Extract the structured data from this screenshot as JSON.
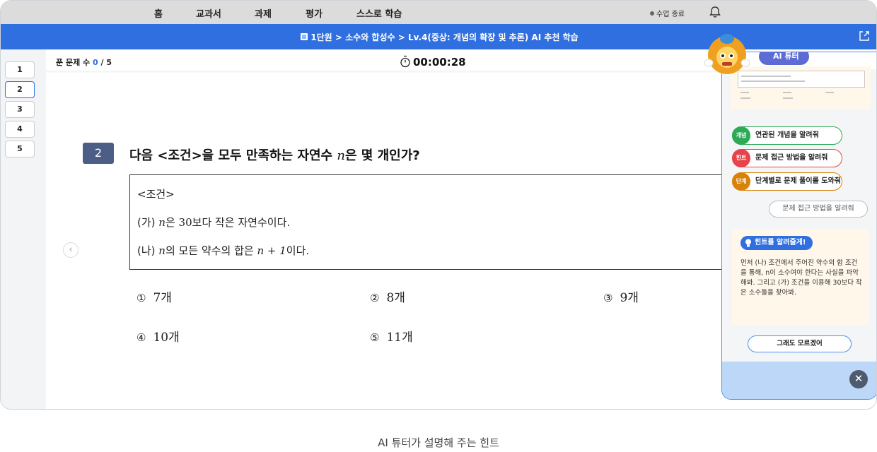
{
  "topnav": {
    "items": [
      "홈",
      "교과서",
      "과제",
      "평가",
      "스스로 학습"
    ],
    "end_class": "수업 종료"
  },
  "breadcrumb": "1단원 > 소수와 합성수 > Lv.4(중상: 개념의 확장 및 추론) AI 추천 학습",
  "questions": [
    "1",
    "2",
    "3",
    "4",
    "5"
  ],
  "status": {
    "solved_label": "푼 문제 수",
    "solved_count": "0",
    "solved_total": "/ 5",
    "timer": "00:00:28"
  },
  "question": {
    "number": "2",
    "text_pre": "다음 <조건>을 모두 만족하는 자연수 ",
    "var": "n",
    "text_post": "은 몇 개인가?",
    "cond_title": "<조건>",
    "cond_a_label": "(가)",
    "cond_a_var": "n",
    "cond_a_mid": "은 ",
    "cond_a_num": "30",
    "cond_a_post": "보다 작은 자연수이다.",
    "cond_b_label": "(나)",
    "cond_b_var": "n",
    "cond_b_mid": "의 모든 약수의 합은 ",
    "cond_b_expr": "n + 1",
    "cond_b_post": "이다."
  },
  "choices": [
    {
      "mark": "①",
      "value": "7",
      "unit": "개"
    },
    {
      "mark": "②",
      "value": "8",
      "unit": "개"
    },
    {
      "mark": "③",
      "value": "9",
      "unit": "개"
    },
    {
      "mark": "④",
      "value": "10",
      "unit": "개"
    },
    {
      "mark": "⑤",
      "value": "11",
      "unit": "개"
    }
  ],
  "tutor": {
    "title": "AI 튜터",
    "chips": [
      {
        "tag": "개념",
        "label": "연관된 개념을 알려줘",
        "color": "#2eaa57"
      },
      {
        "tag": "힌트",
        "label": "문제 접근 방법을 알려줘",
        "color": "#e8434a"
      },
      {
        "tag": "단계",
        "label": "단계별로 문제 풀이를 도와줘",
        "color": "#d9820a"
      }
    ],
    "user_message": "문제 접근 방법을 알려줘",
    "hint_title": "힌트를 알려줄게!",
    "hint_text": "먼저 (나) 조건에서 주어진 약수의 합 조건을 통해, n이 소수여야 한다는 사실을 파악해봐. 그리고 (가) 조건을 이용해 30보다 작은 소수들을 찾아봐.",
    "dont_know": "그래도 모르겠어"
  },
  "caption": "AI 튜터가 설명해 주는 힌트",
  "colors": {
    "accent": "#2f6fe0",
    "tutor_title": "#5d6bd4",
    "qnum_bg": "#4d5e86"
  }
}
